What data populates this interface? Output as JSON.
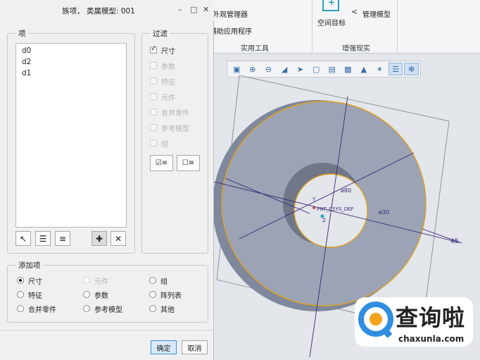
{
  "dialog": {
    "title": "族项，  类属模型: 001",
    "window_controls": {
      "collapse": "–",
      "maximize": "□",
      "close": "✕"
    },
    "items_group": {
      "label": "项",
      "items": [
        "d0",
        "d2",
        "d1"
      ]
    },
    "filter_group": {
      "label": "过滤",
      "options": [
        {
          "label": "尺寸",
          "checked": true,
          "enabled": true
        },
        {
          "label": "参数",
          "checked": false,
          "enabled": false
        },
        {
          "label": "特征",
          "checked": false,
          "enabled": false
        },
        {
          "label": "元件",
          "checked": false,
          "enabled": false
        },
        {
          "label": "合并零件",
          "checked": false,
          "enabled": false
        },
        {
          "label": "参考模型",
          "checked": false,
          "enabled": false
        },
        {
          "label": "组",
          "checked": false,
          "enabled": false
        }
      ]
    },
    "add_group": {
      "label": "添加项",
      "options": [
        {
          "label": "尺寸",
          "selected": true,
          "enabled": true
        },
        {
          "label": "元件",
          "selected": false,
          "enabled": false
        },
        {
          "label": "组",
          "selected": false,
          "enabled": true
        },
        {
          "label": "特征",
          "selected": false,
          "enabled": true
        },
        {
          "label": "参数",
          "selected": false,
          "enabled": true
        },
        {
          "label": "阵列表",
          "selected": false,
          "enabled": true
        },
        {
          "label": "合并零件",
          "selected": false,
          "enabled": true
        },
        {
          "label": "参考模型",
          "selected": false,
          "enabled": true
        },
        {
          "label": "其他",
          "selected": false,
          "enabled": true
        }
      ]
    },
    "ok_label": "确定",
    "cancel_label": "取消"
  },
  "ribbon": {
    "items": [
      "外观管理器",
      "辅助应用程序",
      "空间目标",
      "管理模型"
    ],
    "groups": [
      "实用工具",
      "增强现实"
    ]
  },
  "viewport": {
    "annotations": [
      "ø80",
      "ø30",
      "45",
      "PNT_CSYS_DEF",
      "Y",
      "Z"
    ]
  },
  "watermark": {
    "brand": "查询啦",
    "url": "chaxunla.com"
  },
  "colors": {
    "accent": "#3c8fd8",
    "model_face": "#8a92a6",
    "model_edge": "#e0a020",
    "dimension": "#3a2a7a"
  }
}
